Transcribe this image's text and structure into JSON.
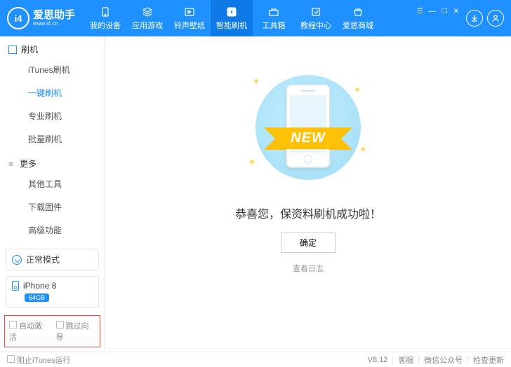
{
  "header": {
    "logo_text": "爱思助手",
    "logo_sub": "www.i4.cn",
    "logo_badge": "i4",
    "nav": [
      {
        "label": "我的设备",
        "icon": "device"
      },
      {
        "label": "应用游戏",
        "icon": "apps"
      },
      {
        "label": "铃声壁纸",
        "icon": "media"
      },
      {
        "label": "智能刷机",
        "icon": "flash",
        "active": true
      },
      {
        "label": "工具箱",
        "icon": "toolbox"
      },
      {
        "label": "教程中心",
        "icon": "tutorial"
      },
      {
        "label": "爱思商城",
        "icon": "store"
      }
    ],
    "win": [
      "☰",
      "—",
      "☐",
      "✕"
    ]
  },
  "sidebar": {
    "section1": {
      "label": "刷机",
      "items": [
        "iTunes刷机",
        "一键刷机",
        "专业刷机",
        "批量刷机"
      ],
      "active_index": 1
    },
    "section2": {
      "label": "更多",
      "items": [
        "其他工具",
        "下载固件",
        "高级功能"
      ]
    },
    "mode": "正常模式",
    "device": {
      "name": "iPhone 8",
      "storage": "64GB"
    },
    "red_opts": [
      "自动激活",
      "跳过向导"
    ]
  },
  "main": {
    "ribbon": "NEW",
    "message": "恭喜您，保资料刷机成功啦！",
    "ok": "确定",
    "log": "查看日志"
  },
  "footer": {
    "left": "阻止iTunes运行",
    "version": "V8.12",
    "links": [
      "客服",
      "微信公众号",
      "检查更新"
    ]
  }
}
